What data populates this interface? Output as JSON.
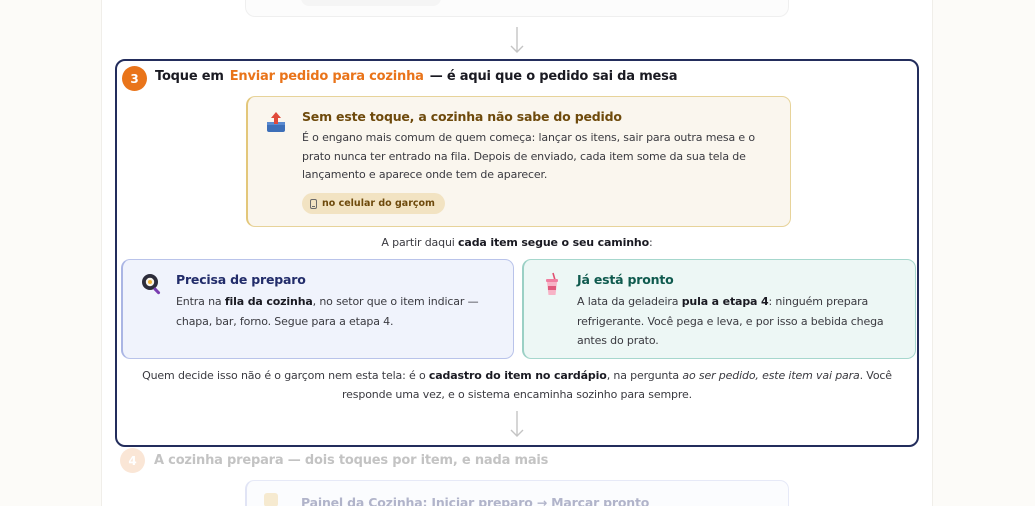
{
  "step3": {
    "number": "3",
    "title_prefix": "Toque em",
    "title_highlight": "Enviar pedido para cozinha",
    "title_suffix": "— é aqui que o pedido sai da mesa",
    "warning": {
      "icon": "outbox-tray-icon",
      "title": "Sem este toque, a cozinha não sabe do pedido",
      "body": "É o engano mais comum de quem começa: lançar os itens, sair para outra mesa e o prato nunca ter entrado na fila. Depois de enviado, cada item some da sua tela de lançamento e aparece onde tem de aparecer.",
      "chip_label": "no celular do garçom",
      "chip_icon": "mobile-phone-icon"
    },
    "split_note": {
      "prefix": "A partir daqui ",
      "bold": "cada item segue o seu caminho",
      "suffix": ":"
    },
    "branches": [
      {
        "icon": "frying-pan-icon",
        "title": "Precisa de preparo",
        "body_prefix": "Entra na ",
        "body_bold": "fila da cozinha",
        "body_suffix": ", no setor que o item indicar — chapa, bar, forno. Segue para a etapa 4."
      },
      {
        "icon": "cup-with-straw-icon",
        "title": "Já está pronto",
        "body_prefix": "A lata da geladeira ",
        "body_bold": "pula a etapa 4",
        "body_suffix": ": ninguém prepara refrigerante. Você pega e leva, e por isso a bebida chega antes do prato."
      }
    ],
    "footer_note": {
      "prefix": "Quem decide isso não é o garçom nem esta tela: é o ",
      "bold": "cadastro do item no cardápio",
      "middle": ", na pergunta ",
      "italic": "ao ser pedido, este item vai para",
      "suffix": ". Você responde uma vez, e o sistema encaminha sozinho para sempre."
    }
  },
  "step4": {
    "number": "4",
    "title": "A cozinha prepara — dois toques por item, e nada mais",
    "card_title": "Painel da Cozinha: Iniciar preparo → Marcar pronto"
  },
  "colors": {
    "accent": "#e9741a",
    "frame": "#232d5c",
    "warning_bg": "#faf6ee",
    "prep_bg": "#f0f3fc",
    "ready_bg": "#edf7f5"
  }
}
